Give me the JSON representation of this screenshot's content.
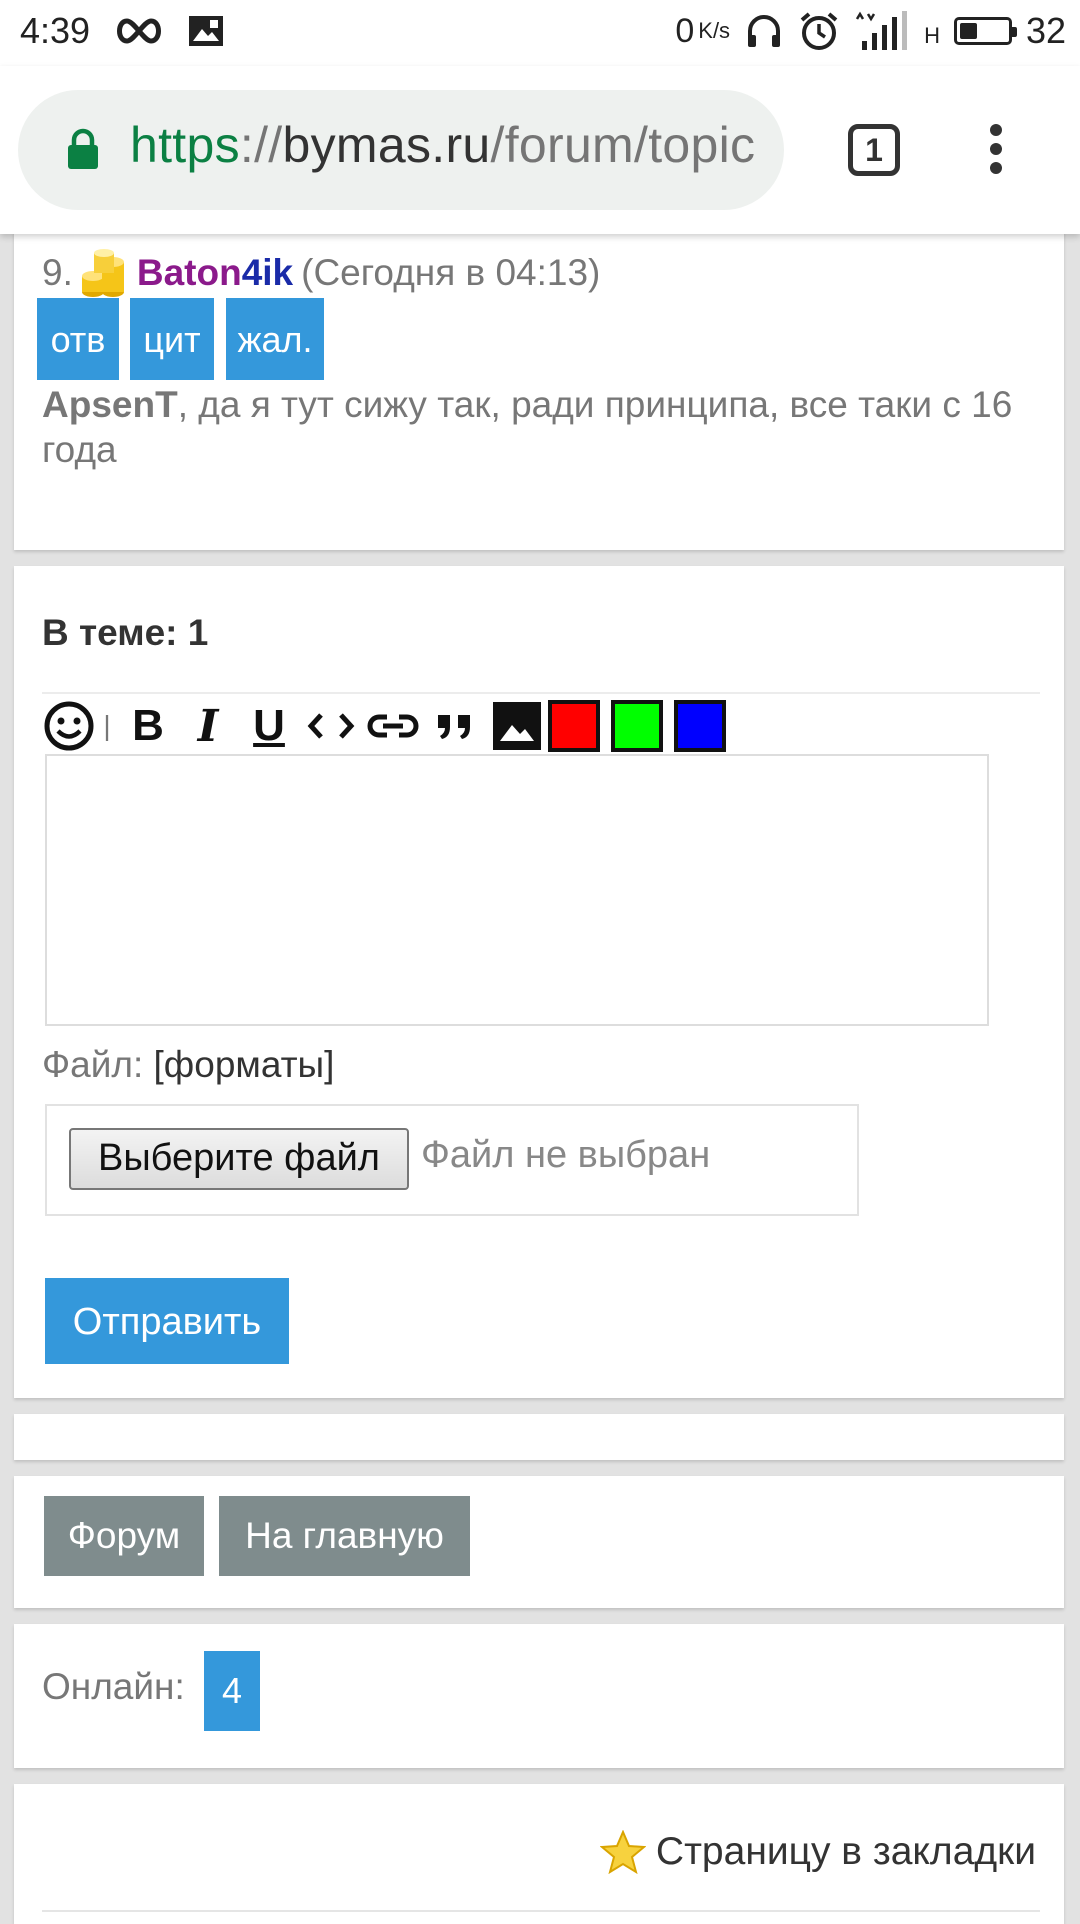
{
  "status_bar": {
    "time": "4:39",
    "speed_value": "0",
    "speed_unit": "K/s",
    "network": "H",
    "battery": "32",
    "battery_level": 0.32
  },
  "browser": {
    "url_scheme": "https",
    "url_sep": "://",
    "url_host": "bymas.ru",
    "url_path": "/forum/topic",
    "tab_count": "1"
  },
  "post": {
    "number": "9.",
    "username_part1": "Baton",
    "username_part2": "4ik",
    "time": "(Сегодня в 04:13)",
    "buttons": [
      "отв",
      "цит",
      "жал."
    ],
    "text_author": "ApsenT",
    "text": ", да я тут сижу так, ради принципа, все таки с 16 года"
  },
  "reply_form": {
    "topic_count": "В теме: 1",
    "colors": {
      "red": "#ff0000",
      "green": "#00ff00",
      "blue": "#0000ff"
    },
    "file_label": "Файл:",
    "file_formats": "[форматы]",
    "choose_file": "Выберите файл",
    "no_file": "Файл не выбран",
    "submit": "Отправить"
  },
  "nav": {
    "forum": "Форум",
    "home": "На главную"
  },
  "online": {
    "label": "Онлайн:",
    "count": "4"
  },
  "footer": {
    "bookmark": "Страницу в закладки"
  }
}
